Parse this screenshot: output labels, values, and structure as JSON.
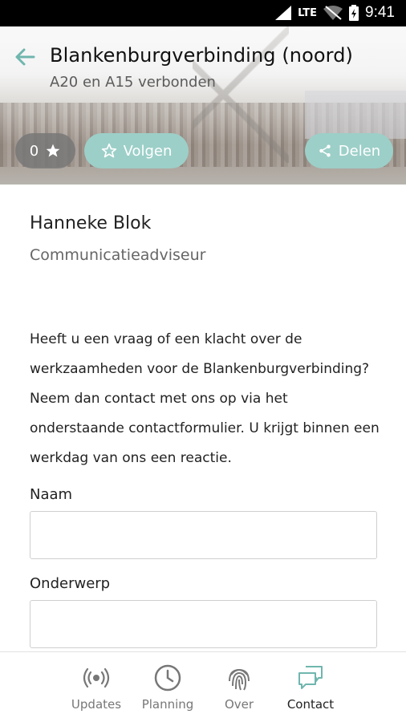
{
  "status_bar": {
    "network": "LTE",
    "time": "9:41"
  },
  "header": {
    "title": "Blankenburgverbinding (noord)",
    "subtitle": "A20 en A15 verbonden",
    "follow_count": "0",
    "follow_label": "Volgen",
    "share_label": "Delen"
  },
  "contact": {
    "name": "Hanneke Blok",
    "role": "Communicatieadviseur",
    "intro": "Heeft u een vraag of een klacht over de werkzaamheden voor de Blankenburgverbinding? Neem dan contact met ons op via het onderstaande contactformulier. U krijgt binnen een werkdag van ons een reactie."
  },
  "form": {
    "name_label": "Naam",
    "name_value": "",
    "subject_label": "Onderwerp",
    "subject_value": ""
  },
  "nav": {
    "items": [
      {
        "label": "Updates",
        "icon": "broadcast-icon"
      },
      {
        "label": "Planning",
        "icon": "clock-icon"
      },
      {
        "label": "Over",
        "icon": "fingerprint-icon"
      },
      {
        "label": "Contact",
        "icon": "chat-icon",
        "active": true
      }
    ]
  },
  "colors": {
    "accent": "#6fb6ae",
    "pill": "#9ccfc8"
  }
}
